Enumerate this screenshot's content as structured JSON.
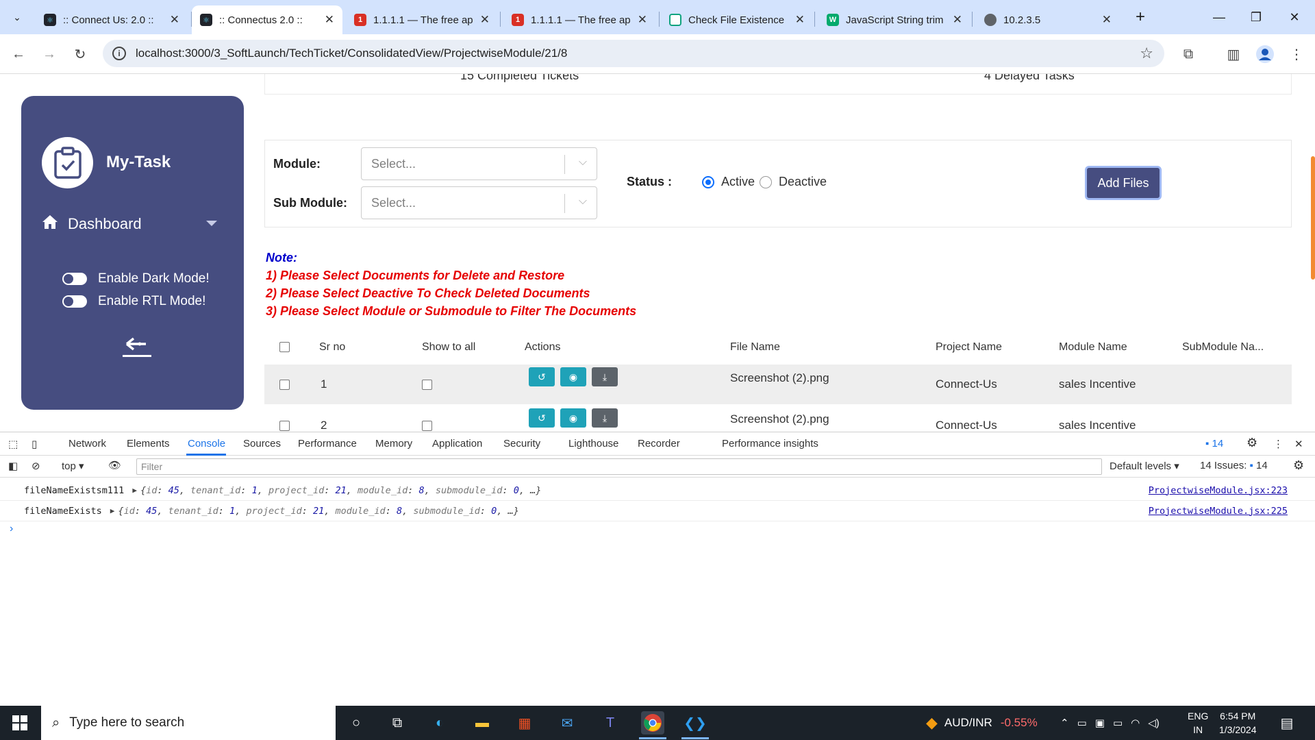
{
  "browser": {
    "tabs": [
      {
        "title": ":: Connect Us: 2.0 ::",
        "favicon": "react-icon",
        "color": "#20232a",
        "active": false
      },
      {
        "title": ":: Connectus 2.0 ::",
        "favicon": "react-icon",
        "color": "#20232a",
        "active": true
      },
      {
        "title": "1.1.1.1 — The free ap",
        "favicon": "cloudflare-icon",
        "color": "#d93025",
        "active": false
      },
      {
        "title": "1.1.1.1 — The free ap",
        "favicon": "cloudflare-icon",
        "color": "#d93025",
        "active": false
      },
      {
        "title": "Check File Existence",
        "favicon": "chatgpt-icon",
        "color": "#10a37f",
        "active": false
      },
      {
        "title": "JavaScript String trim",
        "favicon": "w3-icon",
        "color": "#04aa6d",
        "active": false
      },
      {
        "title": "10.2.3.5",
        "favicon": "globe-icon",
        "color": "#5f6368",
        "active": false
      }
    ],
    "url": "localhost:3000/3_SoftLaunch/TechTicket/ConsolidatedView/ProjectwiseModule/21/8"
  },
  "page": {
    "stats": {
      "completed": "15 Completed Tickets",
      "delayed": "4 Delayed Tasks"
    },
    "sidebar": {
      "app_name": "My-Task",
      "dashboard_label": "Dashboard",
      "dark_mode_label": "Enable Dark Mode!",
      "rtl_mode_label": "Enable RTL Mode!"
    },
    "filters": {
      "module_label": "Module:",
      "module_placeholder": "Select...",
      "submodule_label": "Sub Module:",
      "submodule_placeholder": "Select...",
      "status_label": "Status :",
      "status_active": "Active",
      "status_deactive": "Deactive",
      "status_selected": "Active",
      "add_files_label": "Add Files"
    },
    "note": {
      "title": "Note:",
      "lines": [
        "1) Please Select Documents for Delete and Restore",
        "2) Please Select Deactive To Check Deleted Documents",
        "3) Please Select Module or Submodule to Filter The Documents"
      ]
    },
    "table": {
      "headers": [
        "Sr no",
        "Show to all",
        "Actions",
        "File Name",
        "Project Name",
        "Module Name",
        "SubModule Na..."
      ],
      "rows": [
        {
          "sr": "1",
          "file": "Screenshot (2).png",
          "project": "Connect-Us",
          "module": "sales Incentive",
          "submodule": ""
        },
        {
          "sr": "2",
          "file": "Screenshot (2).png",
          "project": "Connect-Us",
          "module": "sales Incentive",
          "submodule": ""
        }
      ],
      "action_icons": [
        "history-icon",
        "eye-icon",
        "download-icon"
      ]
    }
  },
  "devtools": {
    "tabs": [
      "Network",
      "Elements",
      "Console",
      "Sources",
      "Performance",
      "Memory",
      "Application",
      "Security",
      "Lighthouse",
      "Recorder",
      "Performance insights"
    ],
    "active_tab": "Console",
    "issue_count": "14",
    "context": "top",
    "filter_placeholder": "Filter",
    "levels": "Default levels",
    "issues_label": "14 Issues:",
    "issues_count": "14",
    "logs": [
      {
        "label": "fileNameExistsm111",
        "source": "ProjectwiseModule.jsx:223"
      },
      {
        "label": "fileNameExists",
        "source": "ProjectwiseModule.jsx:225"
      }
    ],
    "log_object": {
      "id": "45",
      "tenant_id": "1",
      "project_id": "21",
      "module_id": "8",
      "submodule_id": "0"
    }
  },
  "taskbar": {
    "search_placeholder": "Type here to search",
    "ticker_name": "AUD/INR",
    "ticker_change": "-0.55%",
    "lang_line1": "ENG",
    "lang_line2": "IN",
    "time": "6:54 PM",
    "date": "1/3/2024"
  },
  "colors": {
    "sidebar_bg": "#464d80",
    "accent_blue": "#0d6efd",
    "note_red": "#e60000",
    "note_blue": "#0000cc",
    "action_teal": "#1fa2b8"
  }
}
